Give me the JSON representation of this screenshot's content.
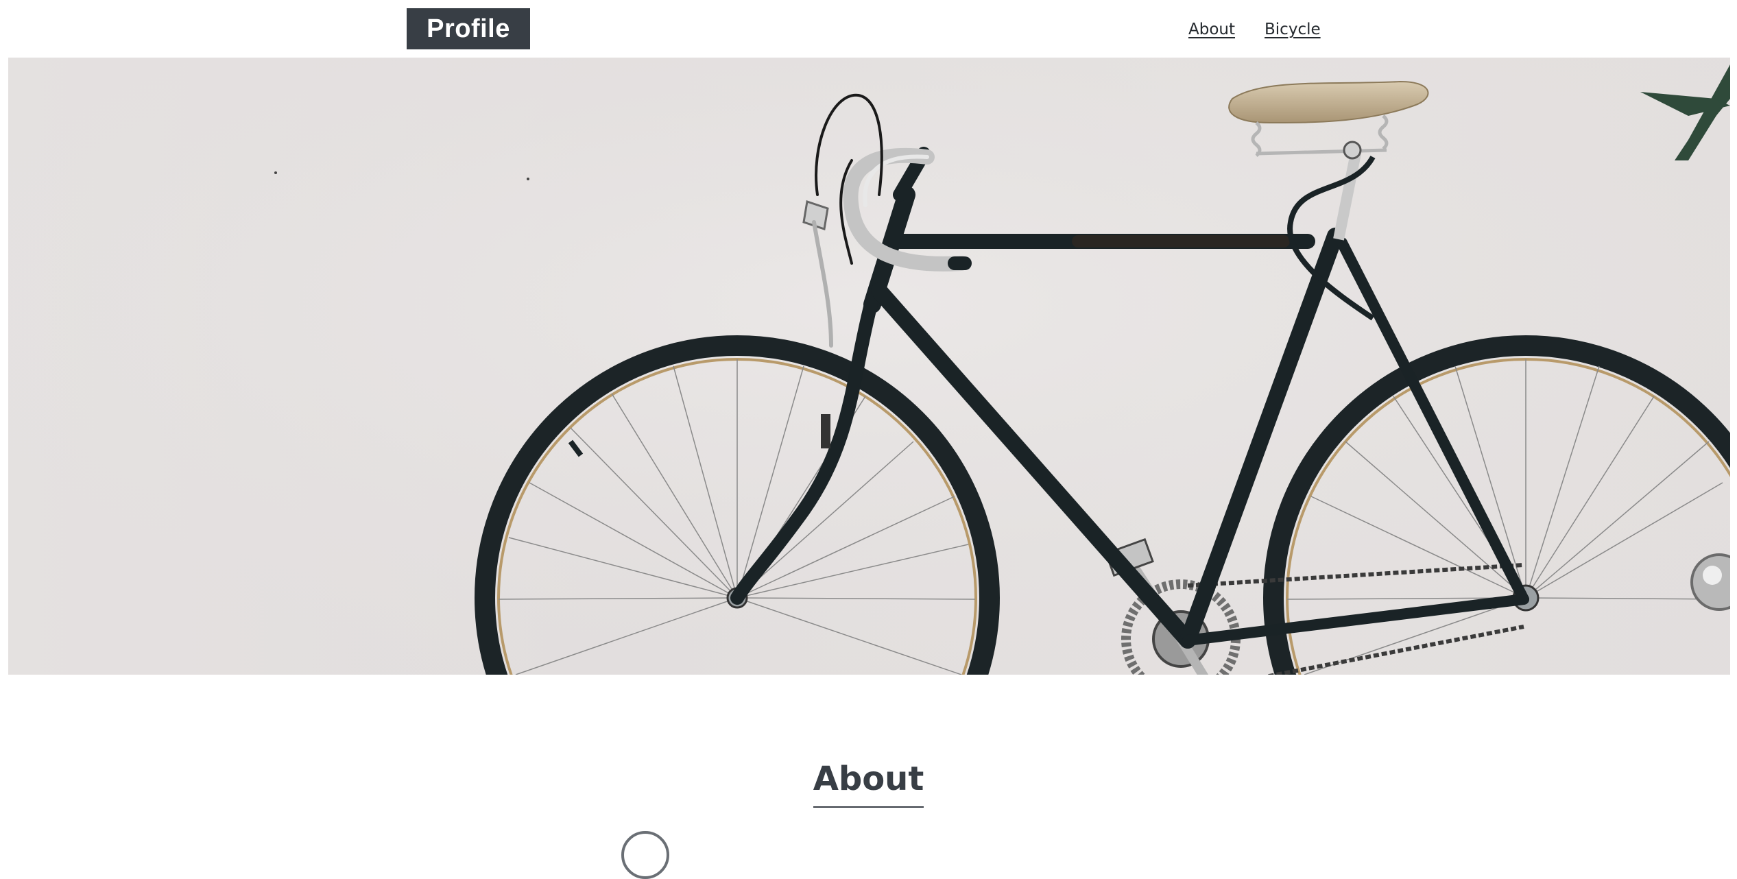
{
  "header": {
    "logo_text": "Profile",
    "nav": [
      {
        "label": "About"
      },
      {
        "label": "Bicycle"
      }
    ]
  },
  "hero": {
    "image": "bicycle-against-white-wall-photo"
  },
  "about": {
    "title": "About"
  },
  "colors": {
    "brand": "#383e45",
    "background": "#ffffff",
    "wall": "#e6e2e1"
  }
}
